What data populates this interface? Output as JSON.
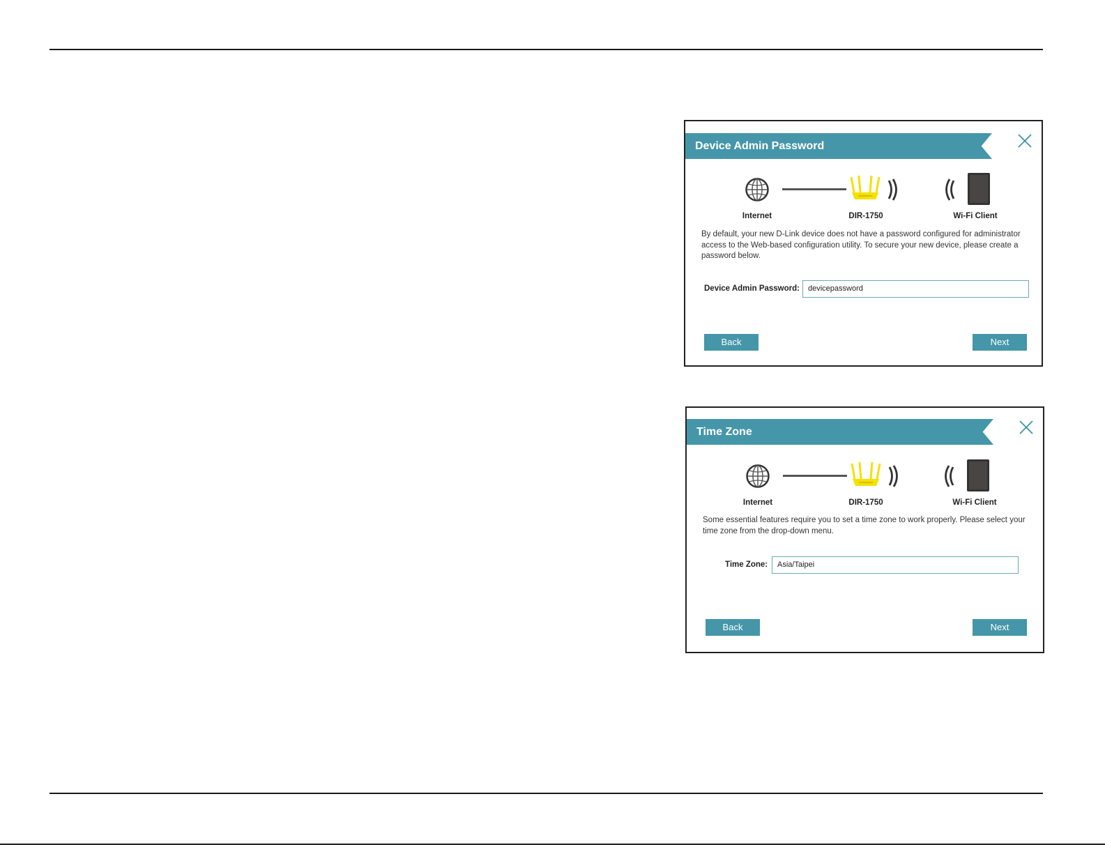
{
  "dialogs": [
    {
      "title": "Device Admin Password",
      "diagram": {
        "internet_label": "Internet",
        "router_label": "DIR-1750",
        "client_label": "Wi-Fi Client"
      },
      "description": "By default, your new D-Link device does not have a password configured for administrator access to the Web-based configuration utility. To secure your new device, please create a password below.",
      "field_label": "Device Admin Password:",
      "field_value": "devicepassword",
      "back_label": "Back",
      "next_label": "Next"
    },
    {
      "title": "Time Zone",
      "diagram": {
        "internet_label": "Internet",
        "router_label": "DIR-1750",
        "client_label": "Wi-Fi Client"
      },
      "description": "Some essential features require you to set a time zone to work properly. Please select your time zone from the drop-down menu.",
      "field_label": "Time Zone:",
      "field_value": "Asia/Taipei",
      "back_label": "Back",
      "next_label": "Next"
    }
  ],
  "colors": {
    "accent": "#4596a8",
    "router": "#f5e000",
    "text": "#222222"
  },
  "icons": {
    "close": "close-icon",
    "internet": "globe-icon",
    "router": "router-icon",
    "wifi": "wifi-signal-icon",
    "client": "tablet-icon"
  }
}
